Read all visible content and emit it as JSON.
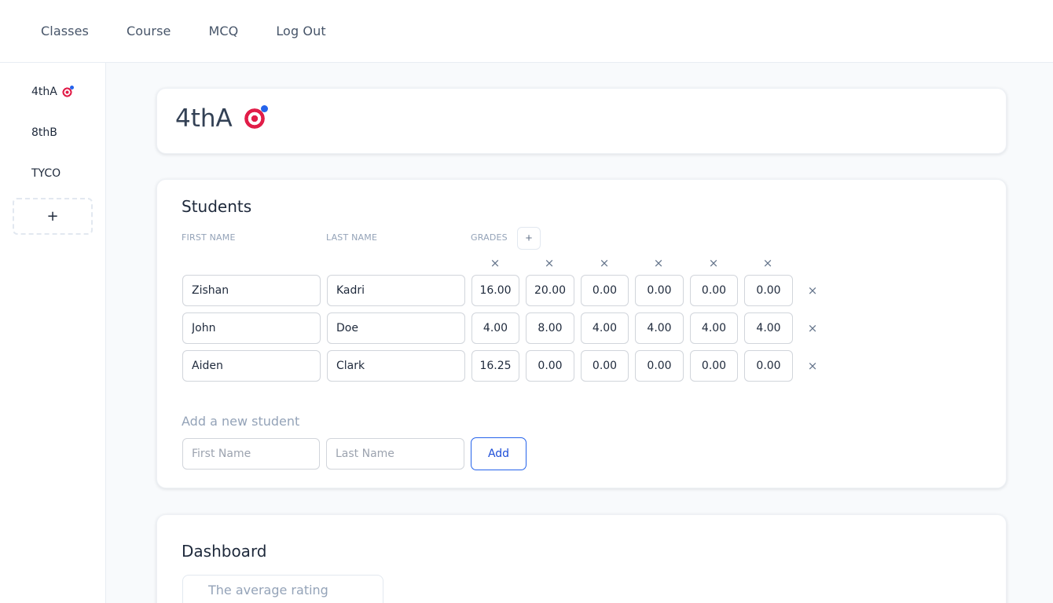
{
  "nav": {
    "items": [
      "Classes",
      "Course",
      "MCQ",
      "Log Out"
    ]
  },
  "sidebar": {
    "classes": [
      {
        "label": "4thA",
        "icon": "target-icon"
      },
      {
        "label": "8thB"
      },
      {
        "label": "TYCO"
      }
    ],
    "add_label": "+"
  },
  "class": {
    "title": "4thA",
    "icon": "target-icon"
  },
  "students": {
    "heading": "Students",
    "columns": {
      "first_name": "FIRST NAME",
      "last_name": "LAST NAME",
      "grades": "GRADES"
    },
    "add_grade_label": "+",
    "remove_symbol": "×",
    "rows": [
      {
        "first": "Zishan",
        "last": "Kadri",
        "grades": [
          "16.00",
          "20.00",
          "0.00",
          "0.00",
          "0.00",
          "0.00"
        ]
      },
      {
        "first": "John",
        "last": "Doe",
        "grades": [
          "4.00",
          "8.00",
          "4.00",
          "4.00",
          "4.00",
          "4.00"
        ]
      },
      {
        "first": "Aiden",
        "last": "Clark",
        "grades": [
          "16.25",
          "0.00",
          "0.00",
          "0.00",
          "0.00",
          "0.00"
        ]
      }
    ],
    "add_new": {
      "label": "Add a new student",
      "first_placeholder": "First Name",
      "last_placeholder": "Last Name",
      "button": "Add"
    }
  },
  "dashboard": {
    "heading": "Dashboard",
    "average_label": "The average rating"
  },
  "colors": {
    "accent": "#2563eb",
    "target_red": "#e11d48"
  }
}
